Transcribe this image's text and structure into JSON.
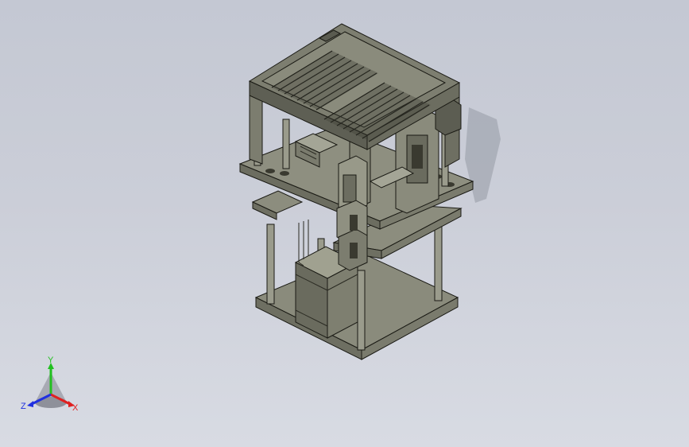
{
  "viewport": {
    "background_top": "#c4c8d3",
    "background_bottom": "#d8dbe3",
    "model_color": "#8a8a7a",
    "model_edge_color": "#1a1a14"
  },
  "triad": {
    "x_label": "X",
    "y_label": "Y",
    "z_label": "Z",
    "x_color": "#e02020",
    "y_color": "#22c020",
    "z_color": "#2030e0"
  }
}
